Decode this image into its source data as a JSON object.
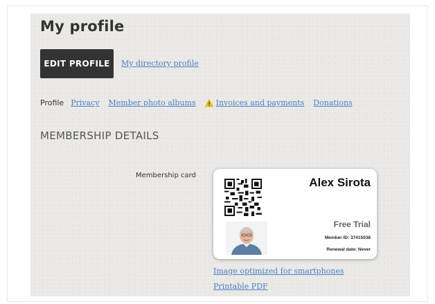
{
  "page": {
    "title": "My profile",
    "edit_button_label": "EDIT PROFILE",
    "directory_link": "My directory profile"
  },
  "tabs": {
    "current": "Profile",
    "links": [
      "Privacy",
      "Member photo albums",
      "Invoices and payments",
      "Donations"
    ],
    "warning_icon": "warning-icon",
    "warning_color": "#f2c200"
  },
  "membership": {
    "heading": "MEMBERSHIP DETAILS",
    "card_label": "Membership card",
    "card": {
      "name": "Alex Sirota",
      "plan": "Free Trial",
      "member_id_label": "Member ID:",
      "member_id": "37415038",
      "renewal_label": "Renewal date:",
      "renewal": "Never"
    },
    "links": {
      "smartphone": "Image optimized for smartphones",
      "pdf": "Printable PDF"
    }
  },
  "colors": {
    "button_bg": "#333333",
    "link": "#4a7fc8",
    "panel_bg": "#e9e8e5"
  }
}
